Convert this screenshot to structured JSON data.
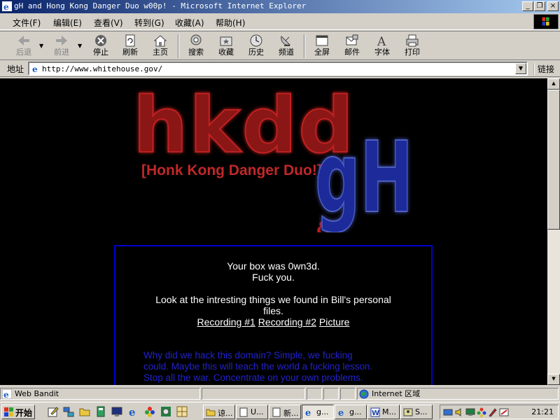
{
  "window": {
    "title": "gH and Hong Kong Danger Duo w00p! - Microsoft Internet Explorer",
    "min_label": "_",
    "max_label": "❐",
    "close_label": "×"
  },
  "menu": [
    "文件(F)",
    "编辑(E)",
    "查看(V)",
    "转到(G)",
    "收藏(A)",
    "帮助(H)"
  ],
  "toolbar": {
    "back": "后退",
    "forward": "前进",
    "stop": "停止",
    "refresh": "刷新",
    "home": "主页",
    "search": "搜索",
    "favorites": "收藏",
    "history": "历史",
    "channels": "频道",
    "fullscreen": "全屏",
    "mail": "邮件",
    "fonts": "字体",
    "print": "打印"
  },
  "address": {
    "label": "地址",
    "url": "http://www.whitehouse.gov/",
    "links_label": "链接"
  },
  "page": {
    "logo_main": "hkdd",
    "logo_sub": "[Honk Kong Danger Duo!]",
    "logo_amp": "&",
    "logo_gh": "gH",
    "line1": "Your box was 0wn3d.",
    "line2": "Fuck you.",
    "line3": "Look at the intresting things we found in Bill's personal",
    "line4": "files.",
    "link1": "Recording #1",
    "link2": "Recording #2",
    "link3": "Picture",
    "blue1": "Why did we hack this domain? Simple, we fucking",
    "blue2": "could. Maybe this will teach the world a fucking lesson.",
    "blue3": "Stop all the war. Concentrate on your own problems.",
    "colors": {
      "background": "#000000",
      "box_border": "#0000cc",
      "blue_text": "#2222cc",
      "logo_red": "#8b1414",
      "logo_blue": "#1a2a9a"
    }
  },
  "status": {
    "left": "Web Bandit",
    "zone": "Internet 区域"
  },
  "taskbar": {
    "start": "开始",
    "quicklaunch": [
      "edit-icon",
      "network-icon",
      "folder-icon",
      "book-icon",
      "monitor-icon",
      "ie-icon",
      "flower-icon",
      "gear-icon",
      "grid-icon"
    ],
    "tasks": [
      {
        "label": "谅...",
        "icon": "folder-icon"
      },
      {
        "label": "U...",
        "icon": "doc-icon"
      },
      {
        "label": "新...",
        "icon": "doc-icon"
      },
      {
        "label": "g...",
        "icon": "ie-icon"
      },
      {
        "label": "g...",
        "icon": "ie-icon"
      },
      {
        "label": "M...",
        "icon": "word-icon"
      },
      {
        "label": "S...",
        "icon": "app-icon"
      }
    ],
    "clock": "21:21"
  }
}
